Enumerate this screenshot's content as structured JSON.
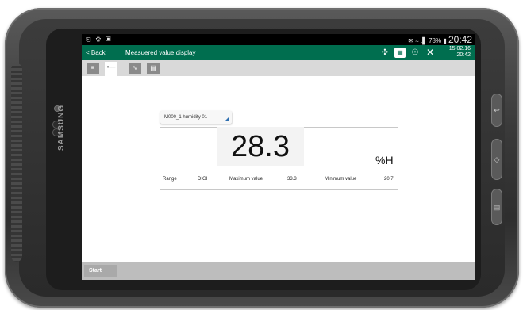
{
  "device": {
    "brand": "SAMSUNG"
  },
  "statusbar": {
    "left_icons": "⎗ ⚙ ▣",
    "right_icons": "©⚡ ↑ .▌ 78% ▮",
    "battery": "78%",
    "time": "20:42"
  },
  "appbar": {
    "back_label": "< Back",
    "title": "Measuered value display",
    "date": "15.02.16",
    "time": "20:42",
    "icons": [
      "wrench-icon",
      "chart-icon",
      "bluetooth-icon",
      "tools-icon"
    ]
  },
  "tabs": [
    {
      "icon": "list-icon",
      "glyph": "≡",
      "active": false
    },
    {
      "icon": "value-display-icon",
      "glyph": "•—",
      "active": true
    },
    {
      "icon": "graph-icon",
      "glyph": "∿",
      "active": false
    },
    {
      "icon": "report-icon",
      "glyph": "▤",
      "active": false
    }
  ],
  "measurement": {
    "channel_select": "M000_1 humidity 01",
    "value": "28.3",
    "unit": "%H"
  },
  "stats": {
    "range_label": "Range",
    "range_value": "DIGI",
    "max_label": "Maximum value",
    "max_value": "33.3",
    "min_label": "Minimum value",
    "min_value": "20.7"
  },
  "bottombar": {
    "start_label": "Start"
  },
  "colors": {
    "accent": "#006e4f",
    "statusbar": "#000000"
  }
}
